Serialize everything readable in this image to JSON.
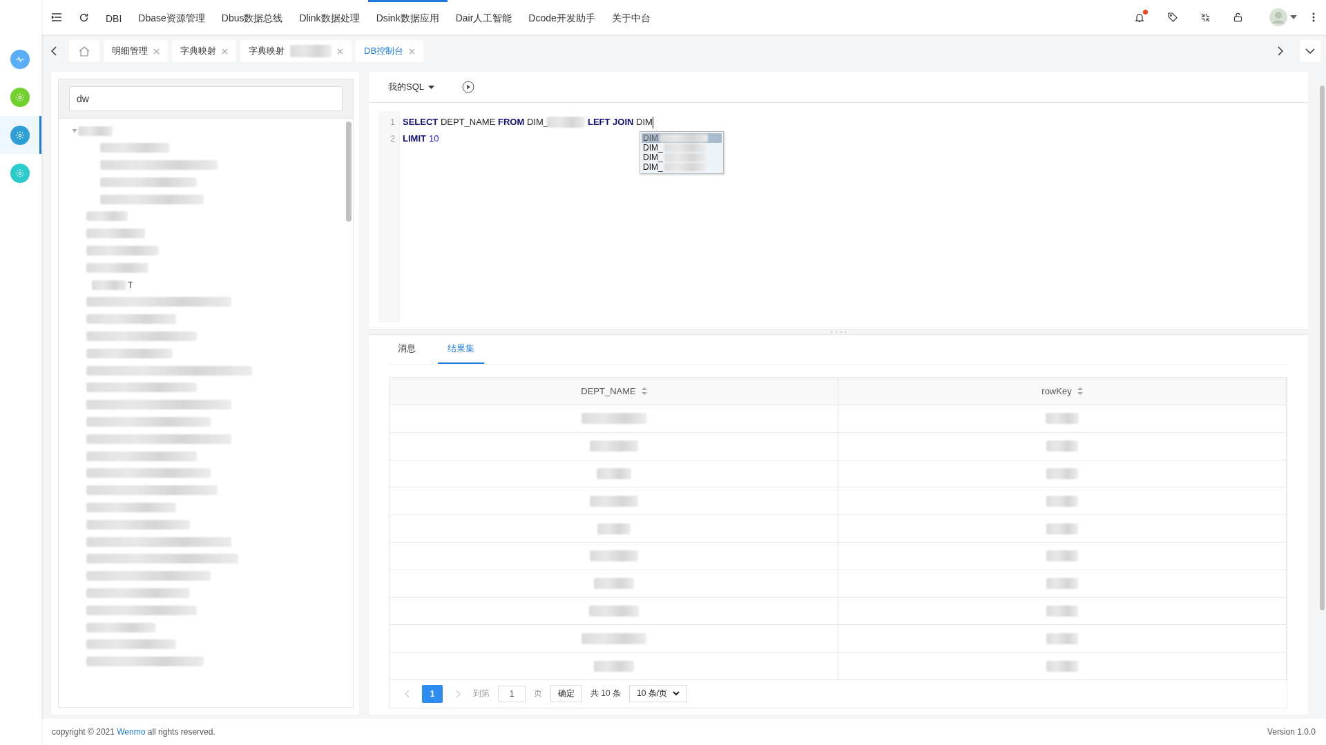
{
  "rail": [
    {
      "color": "#5aaef7",
      "selected": false,
      "kind": "pulse"
    },
    {
      "color": "#72d02c",
      "selected": false,
      "kind": "gear"
    },
    {
      "color": "#2d9fd4",
      "selected": true,
      "kind": "gear"
    },
    {
      "color": "#2ccbcb",
      "selected": false,
      "kind": "gear"
    }
  ],
  "nav": [
    {
      "label": "DBI",
      "selected": false
    },
    {
      "label": "Dbase资源管理",
      "selected": false
    },
    {
      "label": "Dbus数据总线",
      "selected": false
    },
    {
      "label": "Dlink数据处理",
      "selected": false
    },
    {
      "label": "Dsink数据应用",
      "selected": true
    },
    {
      "label": "Dair人工智能",
      "selected": false
    },
    {
      "label": "Dcode开发助手",
      "selected": false
    },
    {
      "label": "关于中台",
      "selected": false
    }
  ],
  "notifications": {
    "unread": true
  },
  "tabs": [
    {
      "label": "明细管理",
      "selected": false,
      "blurred": false
    },
    {
      "label": "字典映射",
      "selected": false,
      "blurred": false
    },
    {
      "label": "字典映射",
      "selected": false,
      "blurred": true
    },
    {
      "label": "DB控制台",
      "selected": true,
      "blurred": false
    }
  ],
  "search": {
    "value": "dw"
  },
  "tree_visible_fragment": "T",
  "editor": {
    "menu": "我的SQL",
    "lines": [
      {
        "number": "1",
        "tokens": [
          {
            "kind": "keyword",
            "text": "SELECT"
          },
          {
            "kind": "plain",
            "text": " DEPT_NAME "
          },
          {
            "kind": "keyword",
            "text": "FROM"
          },
          {
            "kind": "plain",
            "text": " DIM_"
          },
          {
            "kind": "blur"
          },
          {
            "kind": "keyword",
            "text": "LEFT JOIN"
          },
          {
            "kind": "plain",
            "text": " DIM"
          },
          {
            "kind": "cursor"
          }
        ]
      },
      {
        "number": "2",
        "tokens": [
          {
            "kind": "keyword",
            "text": "LIMIT"
          },
          {
            "kind": "number",
            "text": "10"
          }
        ]
      }
    ],
    "suggestions": [
      {
        "text": "DIM",
        "selected": true
      },
      {
        "text": "DIM_",
        "selected": false
      },
      {
        "text": "DIM_",
        "selected": false
      },
      {
        "text": "DIM_",
        "selected": false
      }
    ]
  },
  "result_tabs": [
    {
      "label": "消息",
      "selected": false
    },
    {
      "label": "结果集",
      "selected": true
    }
  ],
  "table": {
    "columns": [
      "DEPT_NAME",
      "rowKey"
    ]
  },
  "pagination": {
    "current": "1",
    "goto_label": "到第",
    "goto_value": "1",
    "page_label": "页",
    "confirm": "确定",
    "total": "共 10 条",
    "page_size": "10 条/页"
  },
  "footer": {
    "copyright": "copyright © 2021 ",
    "link": "Wenmo",
    "rest": " all rights reserved.",
    "version": "Version 1.0.0"
  }
}
